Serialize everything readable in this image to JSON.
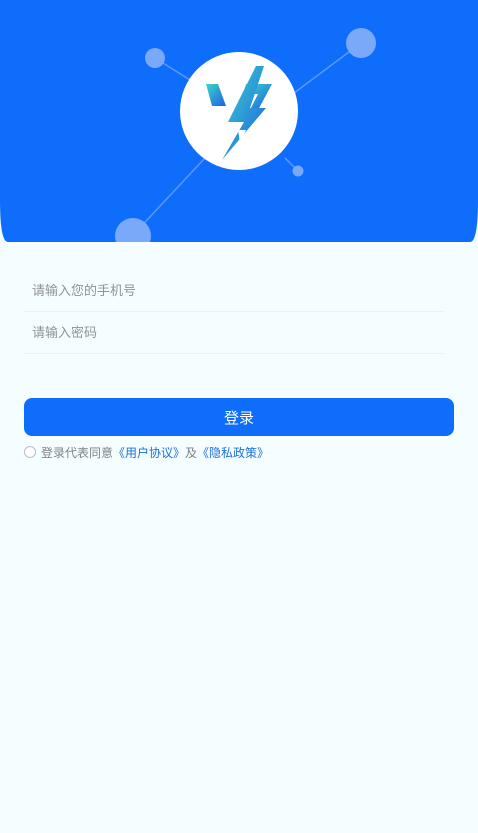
{
  "colors": {
    "header_background": "#0f6dfb",
    "page_background": "#f4fdff",
    "accent": "#0f6dfb",
    "link": "#1e6fd9",
    "logo_gradient_start": "#3ed6c7",
    "logo_gradient_end": "#1c5fe6"
  },
  "header": {
    "logo_icon": "lightning-bolt-logo-icon",
    "decoration": "network-nodes"
  },
  "form": {
    "phone_placeholder": "请输入您的手机号",
    "password_placeholder": "请输入密码",
    "login_label": "登录"
  },
  "agreement": {
    "checked": false,
    "prefix": "登录代表同意",
    "user_agreement": "《用户协议》",
    "conjunction": "及",
    "privacy_policy": "《隐私政策》"
  }
}
